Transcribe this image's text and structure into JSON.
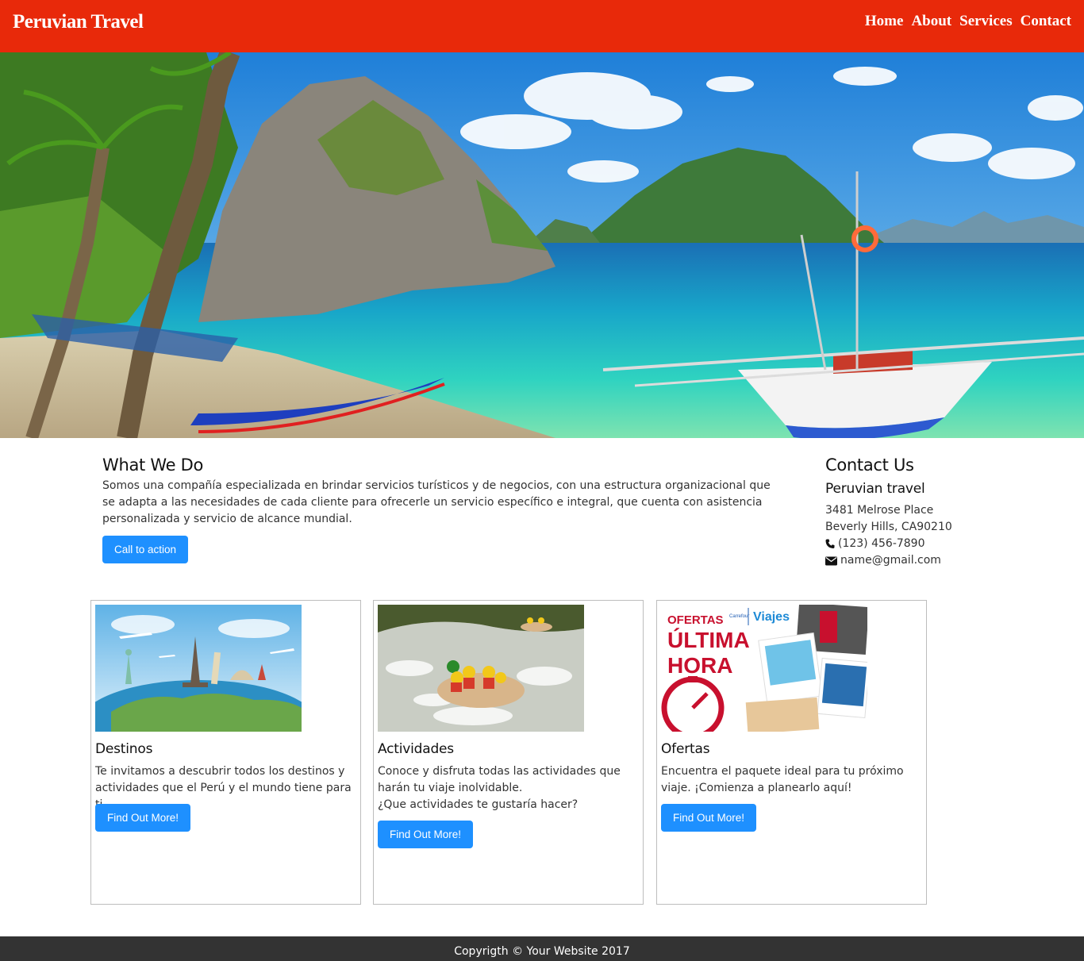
{
  "nav": {
    "brand": "Peruvian Travel",
    "links": [
      "Home",
      "About",
      "Services",
      "Contact"
    ]
  },
  "what_we_do": {
    "title": "What We Do",
    "text": "Somos una compañía especializada en brindar servicios turísticos y de negocios, con una estructura organizacional que se adapta a las necesidades de cada cliente para ofrecerle un servicio específico e integral, que cuenta con asistencia personalizada y servicio de alcance mundial.",
    "button": "Call to action"
  },
  "contact": {
    "title": "Contact Us",
    "company": "Peruvian travel",
    "address1": "3481 Melrose Place",
    "address2": "Beverly Hills, CA90210",
    "phone": "(123) 456-7890",
    "email": "name@gmail.com"
  },
  "cards": [
    {
      "title": "Destinos",
      "text": "Te invitamos a descubrir todos los destinos y actividades que el Perú y el mundo tiene para ti.",
      "button": "Find Out More!"
    },
    {
      "title": "Actividades",
      "text": "Conoce y disfruta todas las actividades que harán tu viaje inolvidable.",
      "text2": "¿Que actividades te gustaría hacer?",
      "button": "Find Out More!"
    },
    {
      "title": "Ofertas",
      "text": "Encuentra el paquete ideal para tu próximo viaje. ¡Comienza a planearlo aquí!",
      "button": "Find Out More!",
      "promo": {
        "ofertas": "OFERTAS",
        "viajes": "Viajes",
        "brand": "Carrefour",
        "ultima": "ÚLTIMA",
        "hora": "HORA"
      }
    }
  ],
  "footer": {
    "text": "Copyrigth © Your Website 2017"
  },
  "colors": {
    "navbar": "#e8290a",
    "button": "#1e90ff",
    "footer": "#333333"
  },
  "icons": {
    "phone": "phone-icon",
    "email": "envelope-icon"
  }
}
